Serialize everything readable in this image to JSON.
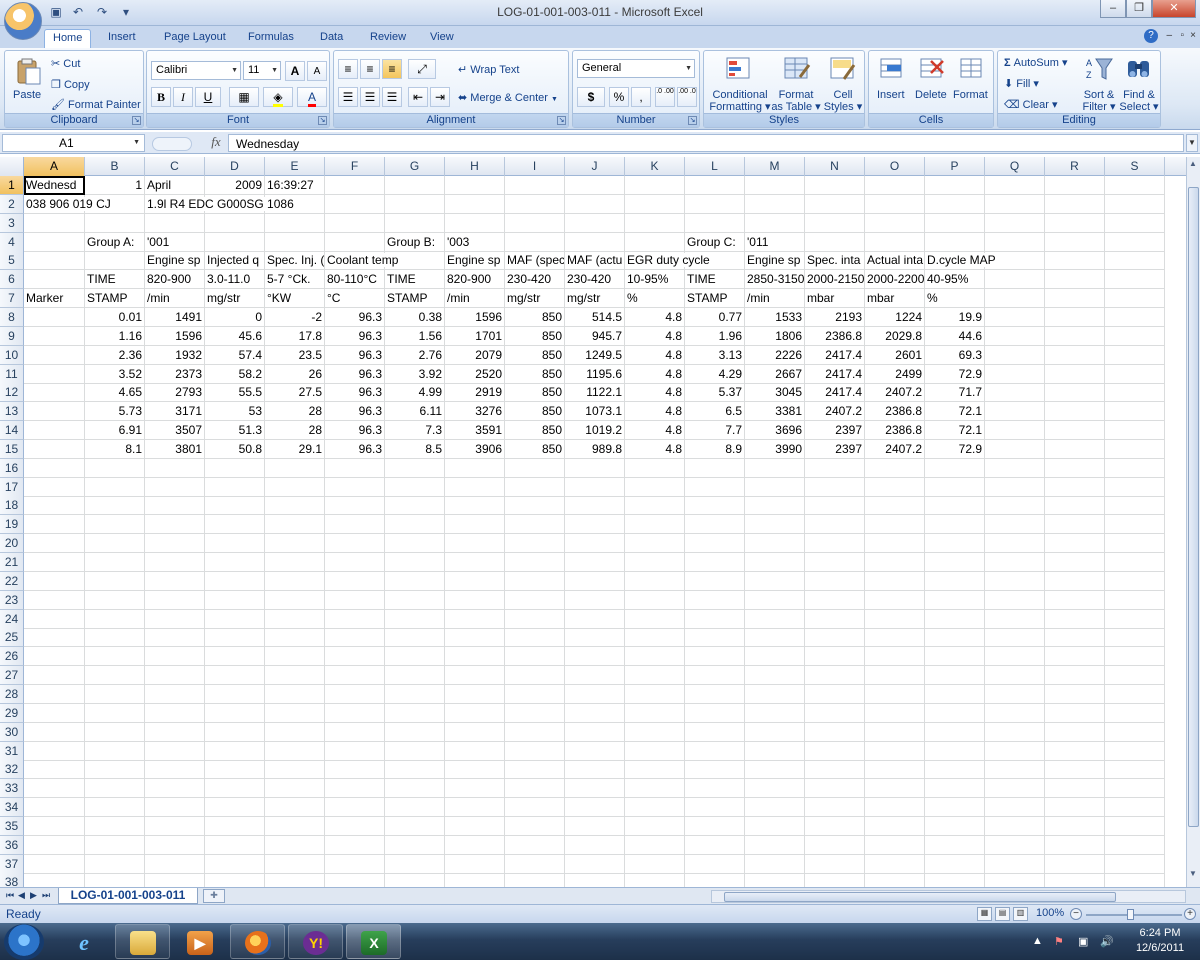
{
  "window": {
    "title": "LOG-01-001-003-011 - Microsoft Excel",
    "minimize": "–",
    "restore": "❐",
    "close": "✕"
  },
  "ribbon_tabs": [
    "Home",
    "Insert",
    "Page Layout",
    "Formulas",
    "Data",
    "Review",
    "View"
  ],
  "clipboard": {
    "paste": "Paste",
    "cut": "Cut",
    "copy": "Copy",
    "format_painter": "Format Painter",
    "label": "Clipboard"
  },
  "font": {
    "name": "Calibri",
    "size": "11",
    "label": "Font",
    "bold": "B",
    "italic": "I",
    "underline": "U",
    "grow": "A",
    "shrink": "A"
  },
  "alignment": {
    "wrap_text": "Wrap Text",
    "merge_center": "Merge & Center",
    "label": "Alignment"
  },
  "number": {
    "format": "General",
    "currency": "$",
    "percent": "%",
    "comma": ",",
    "inc_dec": ".0 .00",
    "dec_dec": ".00 .0",
    "label": "Number"
  },
  "styles": {
    "conditional_1": "Conditional",
    "conditional_2": "Formatting",
    "format_table_1": "Format",
    "format_table_2": "as Table",
    "cell_styles_1": "Cell",
    "cell_styles_2": "Styles",
    "label": "Styles"
  },
  "cells_group": {
    "insert": "Insert",
    "delete": "Delete",
    "format": "Format",
    "label": "Cells"
  },
  "editing": {
    "autosum": "AutoSum",
    "fill": "Fill",
    "clear": "Clear",
    "sort_1": "Sort &",
    "sort_2": "Filter",
    "find_1": "Find &",
    "find_2": "Select",
    "label": "Editing"
  },
  "formula_bar": {
    "name_box": "A1",
    "fx": "fx",
    "content": "Wednesday"
  },
  "columns": [
    "A",
    "B",
    "C",
    "D",
    "E",
    "F",
    "G",
    "H",
    "I",
    "J",
    "K",
    "L",
    "M",
    "N",
    "O",
    "P",
    "Q",
    "R",
    "S"
  ],
  "rows": [
    [
      "Wednesd",
      "1",
      "April",
      "2009",
      "16:39:27",
      "",
      "",
      "",
      "",
      "",
      "",
      "",
      "",
      "",
      "",
      "",
      "",
      "",
      ""
    ],
    [
      "038 906 019 CJ",
      "",
      "1.9l R4 EDC G000SG  1086",
      "",
      "",
      "",
      "",
      "",
      "",
      "",
      "",
      "",
      "",
      "",
      "",
      "",
      "",
      "",
      ""
    ],
    [
      "",
      "",
      "",
      "",
      "",
      "",
      "",
      "",
      "",
      "",
      "",
      "",
      "",
      "",
      "",
      "",
      "",
      "",
      ""
    ],
    [
      "",
      "Group A:",
      "'001",
      "",
      "",
      "",
      "Group B:",
      "'003",
      "",
      "",
      "",
      "Group C:",
      "'011",
      "",
      "",
      "",
      "",
      "",
      ""
    ],
    [
      "",
      "",
      "Engine sp",
      "Injected q",
      "Spec. Inj. (",
      "Coolant temp",
      "",
      "Engine sp",
      "MAF (spec",
      "MAF (actu",
      "EGR duty cycle",
      "",
      "Engine sp",
      "Spec. inta",
      "Actual inta",
      "D.cycle MAP",
      "",
      "",
      ""
    ],
    [
      "",
      "TIME",
      "820-900",
      "3.0-11.0",
      "5-7 °Ck.",
      "80-110°C",
      "TIME",
      "820-900",
      "230-420",
      "230-420",
      "10-95%",
      "TIME",
      "2850-3150",
      "2000-2150",
      "2000-2200",
      "40-95%",
      "",
      "",
      ""
    ],
    [
      "Marker",
      "STAMP",
      " /min",
      "mg/str",
      "°KW",
      "°C",
      "STAMP",
      " /min",
      "mg/str",
      "mg/str",
      "%",
      "STAMP",
      " /min",
      "mbar",
      "mbar",
      "%",
      "",
      "",
      ""
    ],
    [
      "",
      "0.01",
      "1491",
      "0",
      "-2",
      "96.3",
      "0.38",
      "1596",
      "850",
      "514.5",
      "4.8",
      "0.77",
      "1533",
      "2193",
      "1224",
      "19.9",
      "",
      "",
      ""
    ],
    [
      "",
      "1.16",
      "1596",
      "45.6",
      "17.8",
      "96.3",
      "1.56",
      "1701",
      "850",
      "945.7",
      "4.8",
      "1.96",
      "1806",
      "2386.8",
      "2029.8",
      "44.6",
      "",
      "",
      ""
    ],
    [
      "",
      "2.36",
      "1932",
      "57.4",
      "23.5",
      "96.3",
      "2.76",
      "2079",
      "850",
      "1249.5",
      "4.8",
      "3.13",
      "2226",
      "2417.4",
      "2601",
      "69.3",
      "",
      "",
      ""
    ],
    [
      "",
      "3.52",
      "2373",
      "58.2",
      "26",
      "96.3",
      "3.92",
      "2520",
      "850",
      "1195.6",
      "4.8",
      "4.29",
      "2667",
      "2417.4",
      "2499",
      "72.9",
      "",
      "",
      ""
    ],
    [
      "",
      "4.65",
      "2793",
      "55.5",
      "27.5",
      "96.3",
      "4.99",
      "2919",
      "850",
      "1122.1",
      "4.8",
      "5.37",
      "3045",
      "2417.4",
      "2407.2",
      "71.7",
      "",
      "",
      ""
    ],
    [
      "",
      "5.73",
      "3171",
      "53",
      "28",
      "96.3",
      "6.11",
      "3276",
      "850",
      "1073.1",
      "4.8",
      "6.5",
      "3381",
      "2407.2",
      "2386.8",
      "72.1",
      "",
      "",
      ""
    ],
    [
      "",
      "6.91",
      "3507",
      "51.3",
      "28",
      "96.3",
      "7.3",
      "3591",
      "850",
      "1019.2",
      "4.8",
      "7.7",
      "3696",
      "2397",
      "2386.8",
      "72.1",
      "",
      "",
      ""
    ],
    [
      "",
      "8.1",
      "3801",
      "50.8",
      "29.1",
      "96.3",
      "8.5",
      "3906",
      "850",
      "989.8",
      "4.8",
      "8.9",
      "3990",
      "2397",
      "2407.2",
      "72.9",
      "",
      "",
      ""
    ]
  ],
  "total_rows": 38,
  "sheet": {
    "tab_name": "LOG-01-001-003-011"
  },
  "status": {
    "ready": "Ready",
    "zoom": "100%"
  },
  "taskbar": {
    "time": "6:24 PM",
    "date": "12/6/2011"
  }
}
